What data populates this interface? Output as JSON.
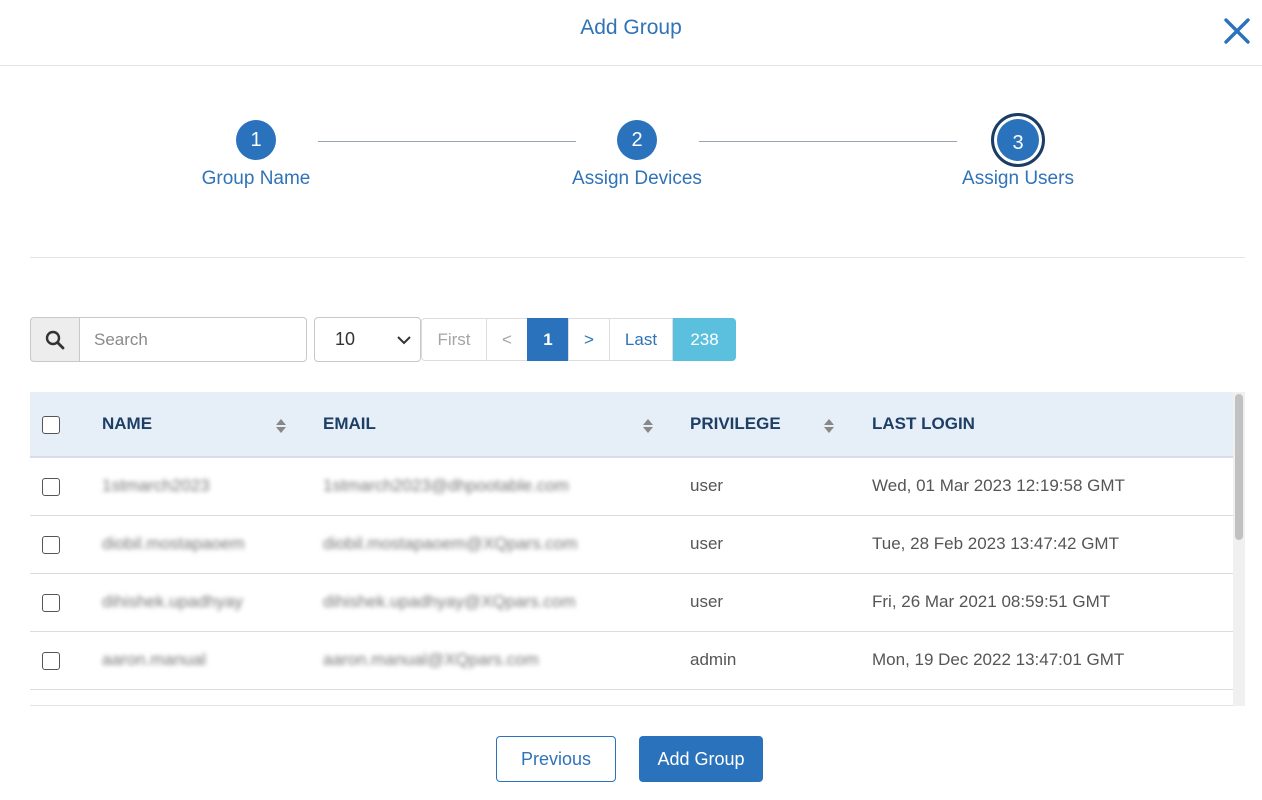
{
  "modal": {
    "title": "Add Group"
  },
  "icons": {
    "close": "close-icon",
    "search": "search-icon",
    "select_chevron": "chevron-down-icon",
    "sort": "sort-icon"
  },
  "colors": {
    "primary": "#2a72bc",
    "header_bg": "#e6eef7",
    "count_badge": "#5bc0de"
  },
  "steps": [
    {
      "number": "1",
      "label": "Group Name",
      "state": "complete"
    },
    {
      "number": "2",
      "label": "Assign Devices",
      "state": "complete"
    },
    {
      "number": "3",
      "label": "Assign Users",
      "state": "active"
    }
  ],
  "search": {
    "placeholder": "Search",
    "value": ""
  },
  "page_size": {
    "selected": "10"
  },
  "pagination": {
    "first": "First",
    "prev": "<",
    "current": "1",
    "next": ">",
    "last": "Last",
    "total": "238"
  },
  "table": {
    "columns": [
      "NAME",
      "EMAIL",
      "PRIVILEGE",
      "LAST LOGIN"
    ],
    "rows": [
      {
        "name": "1stmarch2023",
        "email": "1stmarch2023@dhpootable.com",
        "privilege": "user",
        "last_login": "Wed, 01 Mar 2023 12:19:58 GMT"
      },
      {
        "name": "diobil.mostapaoem",
        "email": "diobil.mostapaoem@XQpars.com",
        "privilege": "user",
        "last_login": "Tue, 28 Feb 2023 13:47:42 GMT"
      },
      {
        "name": "dihishek.upadhyay",
        "email": "dihishek.upadhyay@XQpars.com",
        "privilege": "user",
        "last_login": "Fri, 26 Mar 2021 08:59:51 GMT"
      },
      {
        "name": "aaron.manual",
        "email": "aaron.manual@XQpars.com",
        "privilege": "admin",
        "last_login": "Mon, 19 Dec 2022 13:47:01 GMT"
      }
    ]
  },
  "footer": {
    "previous_label": "Previous",
    "submit_label": "Add Group"
  }
}
